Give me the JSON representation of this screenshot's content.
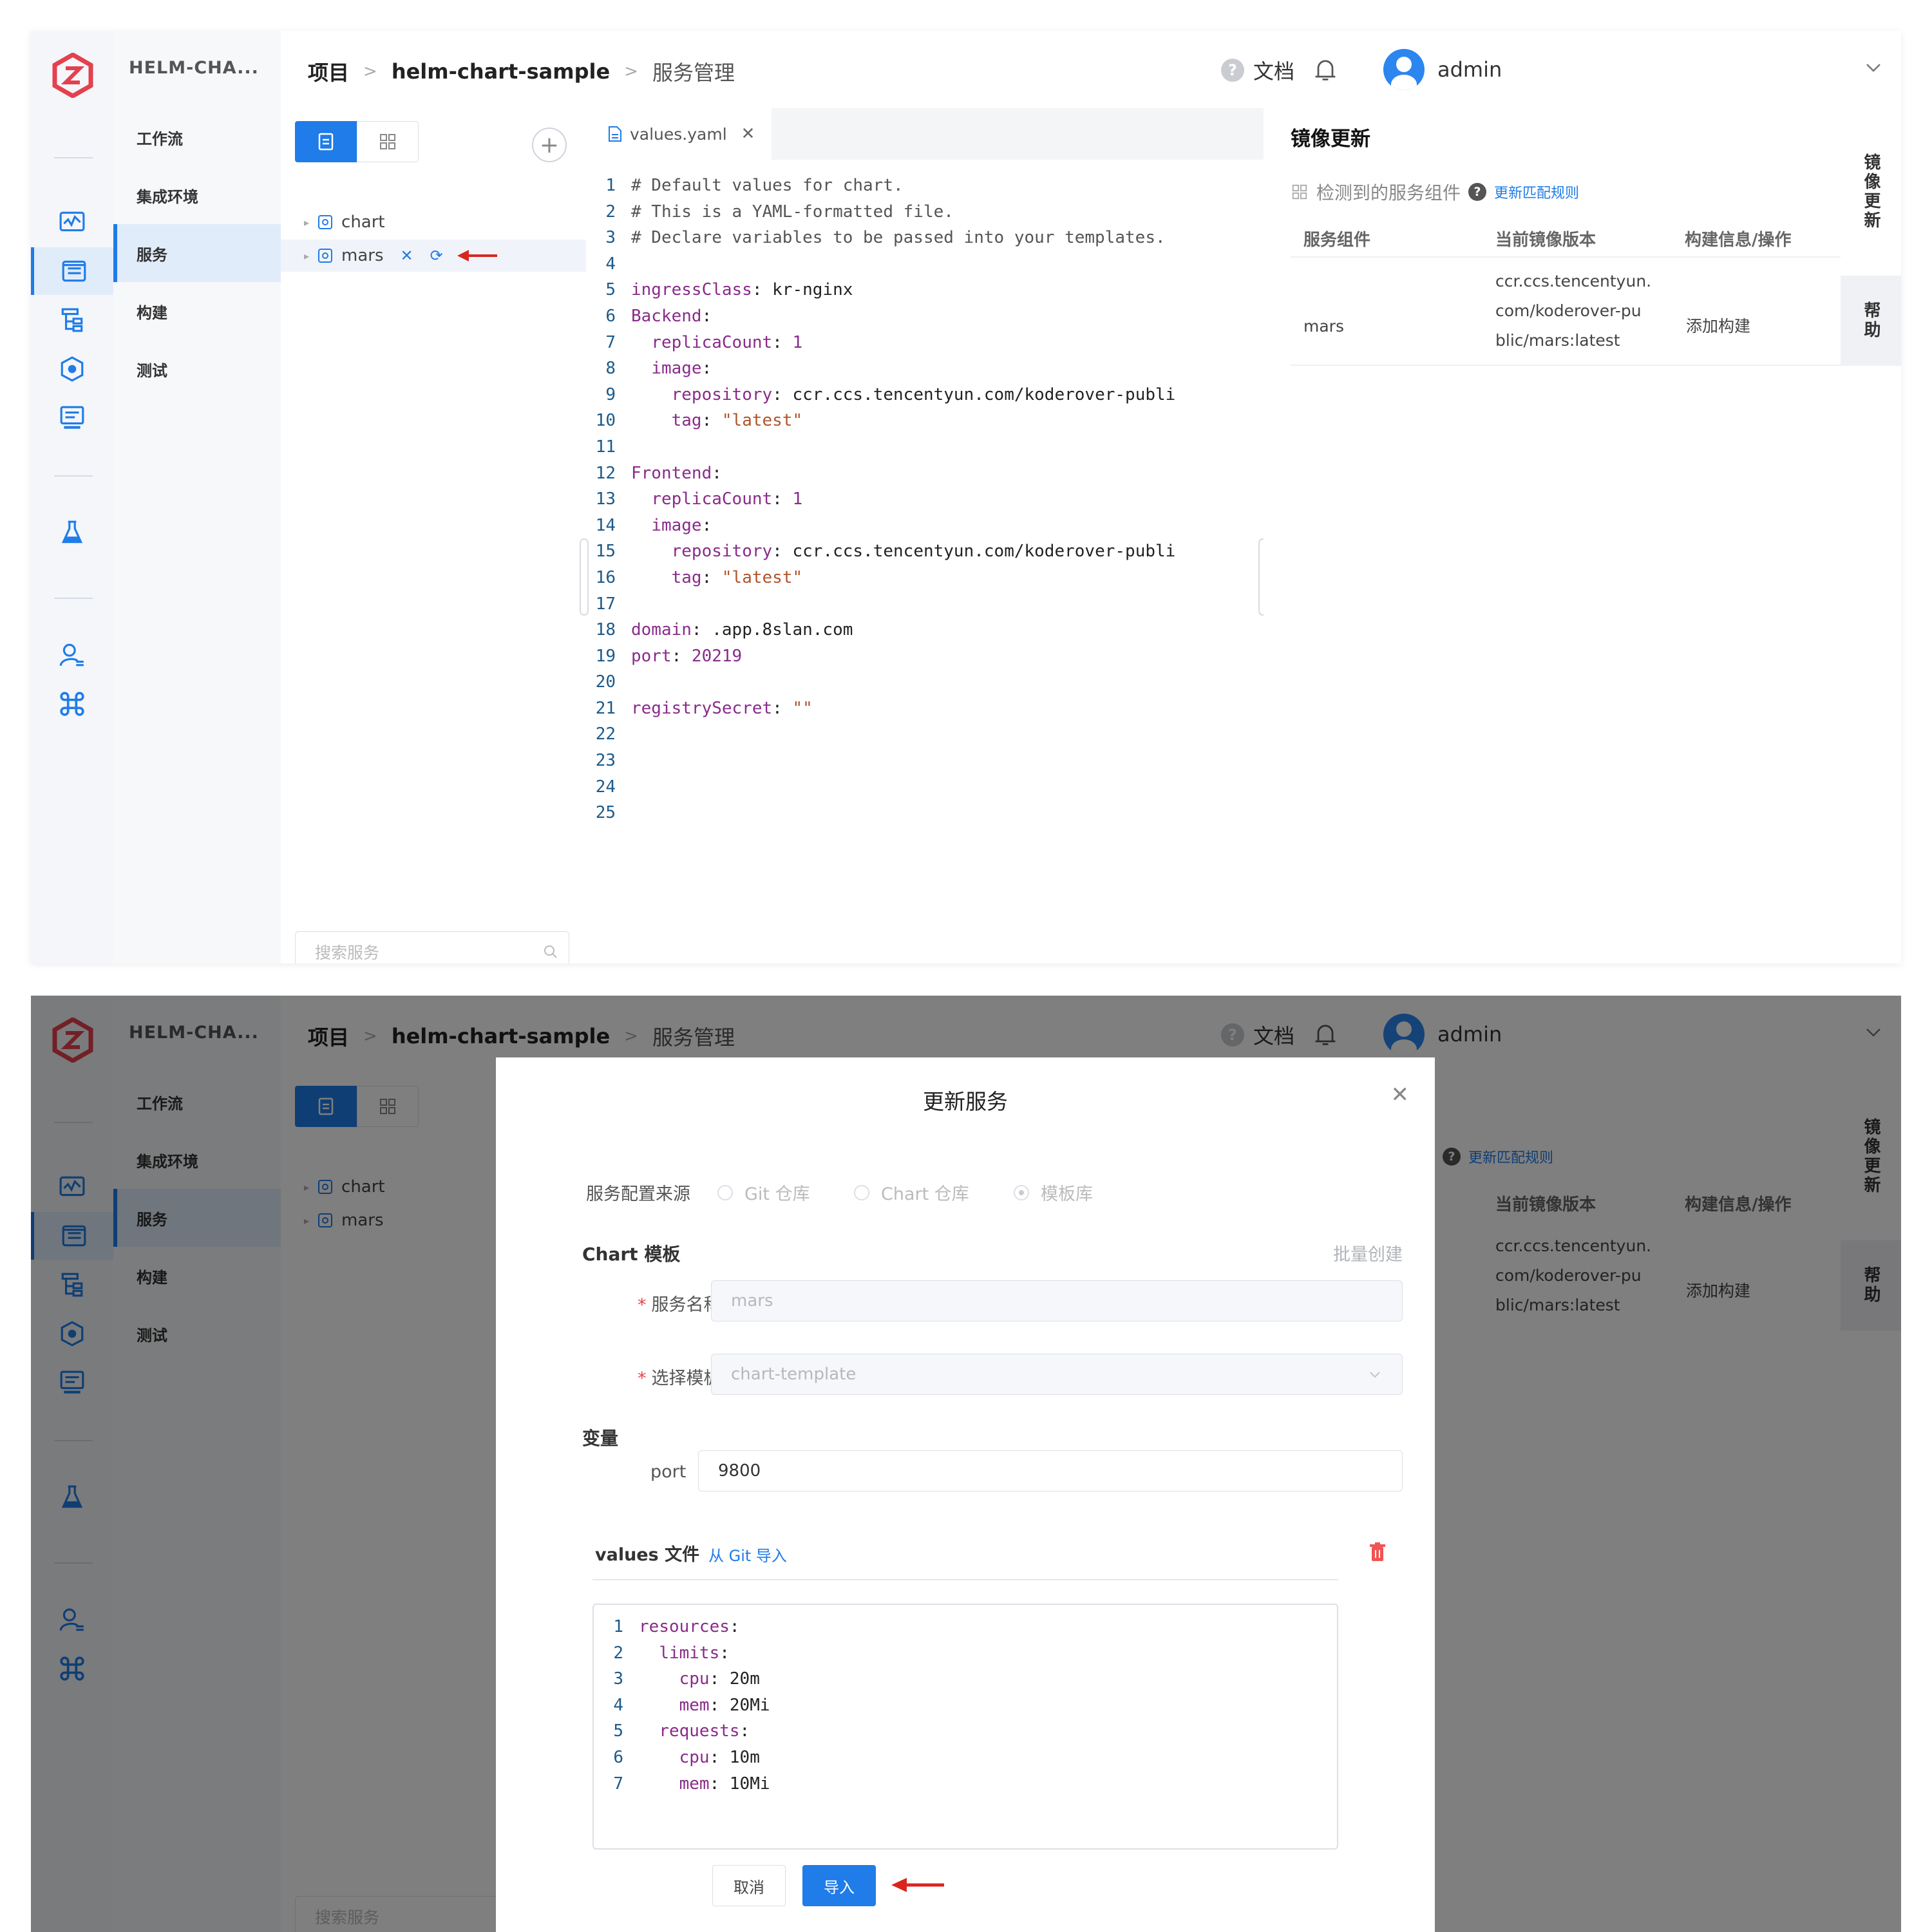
{
  "project_name": "HELM-CHA...",
  "nav_items": [
    "工作流",
    "集成环境",
    "服务",
    "构建",
    "测试"
  ],
  "breadcrumb": {
    "root": "项目",
    "project": "helm-chart-sample",
    "current": "服务管理"
  },
  "header": {
    "docs_label": "文档",
    "username": "admin"
  },
  "tree": {
    "nodes": [
      "chart",
      "mars"
    ],
    "search_placeholder": "搜索服务"
  },
  "editor": {
    "tab_name": "values.yaml",
    "lines": [
      "# Default values for chart.",
      "# This is a YAML-formatted file.",
      "# Declare variables to be passed into your templates.",
      "",
      "ingressClass: kr-nginx",
      "Backend:",
      "  replicaCount: 1",
      "  image:",
      "    repository: ccr.ccs.tencentyun.com/koderover-publi",
      "    tag: \"latest\"",
      "",
      "Frontend:",
      "  replicaCount: 1",
      "  image:",
      "    repository: ccr.ccs.tencentyun.com/koderover-publi",
      "    tag: \"latest\"",
      "",
      "domain: .app.8slan.com",
      "port: 20219",
      "",
      "registrySecret: \"\"",
      "",
      "",
      "",
      ""
    ]
  },
  "image_panel": {
    "title": "镜像更新",
    "detected_label": "检测到的服务组件",
    "rules_link": "更新匹配规则",
    "columns": [
      "服务组件",
      "当前镜像版本",
      "构建信息/操作"
    ],
    "rows": [
      {
        "service": "mars",
        "image_lines": [
          "ccr.ccs.tencentyun.",
          "com/koderover-pu",
          "blic/mars:latest"
        ],
        "action": "添加构建"
      }
    ]
  },
  "side_tabs": [
    "镜像更新",
    "帮助"
  ],
  "dialog": {
    "title": "更新服务",
    "source_label": "服务配置来源",
    "source_options": [
      "Git 仓库",
      "Chart 仓库",
      "模板库"
    ],
    "selected_source": "模板库",
    "chart_template_section": "Chart 模板",
    "batch_create": "批量创建",
    "service_name_label": "服务名称",
    "service_name_value": "mars",
    "template_label": "选择模板",
    "template_value": "chart-template",
    "variables_section": "变量",
    "var_name": "port",
    "var_value": "9800",
    "values_file_label": "values 文件",
    "git_import_link": "从 Git 导入",
    "values_lines": [
      "resources:",
      "  limits:",
      "    cpu: 20m",
      "    mem: 20Mi",
      "  requests:",
      "    cpu: 10m",
      "    mem: 10Mi"
    ],
    "cancel_label": "取消",
    "import_label": "导入"
  },
  "colors": {
    "accent": "#1f7ce8",
    "logo": "#e5404d",
    "arrow": "#d8261f",
    "delete": "#f05454"
  }
}
